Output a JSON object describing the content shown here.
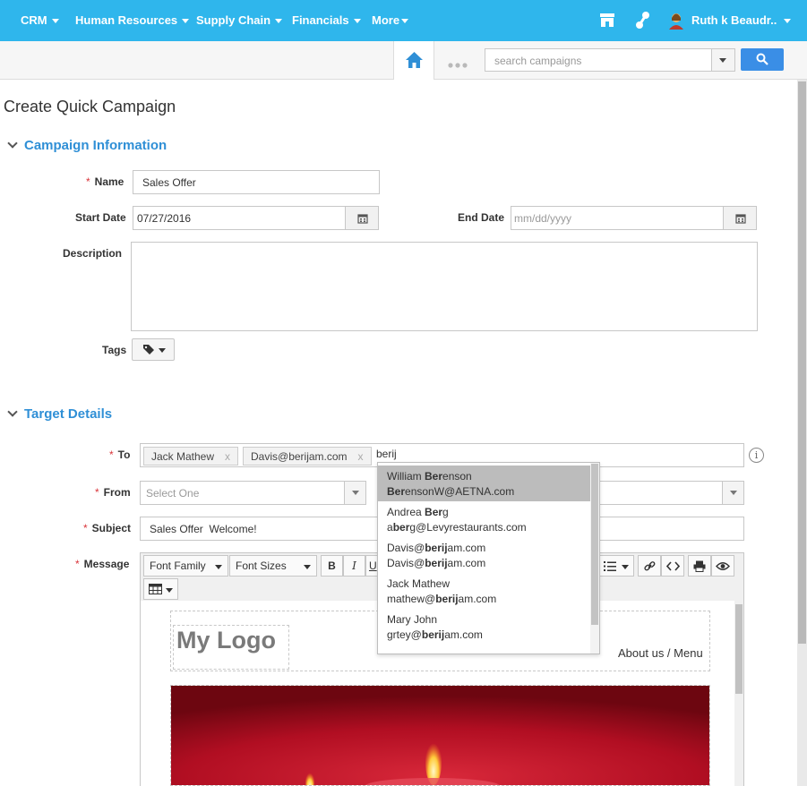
{
  "nav": {
    "items": [
      {
        "label": "CRM"
      },
      {
        "label": "Human Resources"
      },
      {
        "label": "Supply Chain"
      },
      {
        "label": "Financials"
      },
      {
        "label": "More"
      }
    ],
    "user_name": "Ruth k Beaudr..",
    "accent": "#2fb6ec"
  },
  "search": {
    "placeholder": "search campaigns"
  },
  "page_title": "Create Quick Campaign",
  "campaign_info": {
    "heading": "Campaign Information",
    "name_label": "Name",
    "name_value": "Sales Offer",
    "start_label": "Start Date",
    "start_value": "07/27/2016",
    "end_label": "End Date",
    "end_placeholder": "mm/dd/yyyy",
    "description_label": "Description",
    "tags_label": "Tags"
  },
  "target": {
    "heading": "Target Details",
    "to_label": "To",
    "to_chips": [
      "Jack Mathew",
      "Davis@berijam.com"
    ],
    "to_typed": "berij",
    "from_label": "From",
    "from_placeholder": "Select One",
    "subject_label": "Subject",
    "subject_value": "Sales Offer  Welcome!",
    "message_label": "Message"
  },
  "editor": {
    "font_family": "Font Family",
    "font_sizes": "Font Sizes",
    "bold": "B",
    "italic": "I",
    "underline": "U",
    "logo_text": "My Logo",
    "menu_text": "About us / Menu"
  },
  "suggestions": [
    {
      "name_pre": "William ",
      "name_hl": "Ber",
      "name_post": "enson",
      "email_pre": "",
      "email_hl": "Ber",
      "email_post": "ensonW@AETNA.com",
      "active": true
    },
    {
      "name_pre": "Andrea ",
      "name_hl": "Ber",
      "name_post": "g",
      "email_pre": "a",
      "email_hl": "ber",
      "email_post": "g@Levyrestaurants.com"
    },
    {
      "name_pre": "Davis@",
      "name_hl": "berij",
      "name_post": "am.com",
      "email_pre": "Davis@",
      "email_hl": "berij",
      "email_post": "am.com"
    },
    {
      "name_pre": "Jack Mathew",
      "name_hl": "",
      "name_post": "",
      "email_pre": "mathew@",
      "email_hl": "berij",
      "email_post": "am.com"
    },
    {
      "name_pre": "Mary John",
      "name_hl": "",
      "name_post": "",
      "email_pre": "grtey@",
      "email_hl": "berij",
      "email_post": "am.com"
    }
  ]
}
